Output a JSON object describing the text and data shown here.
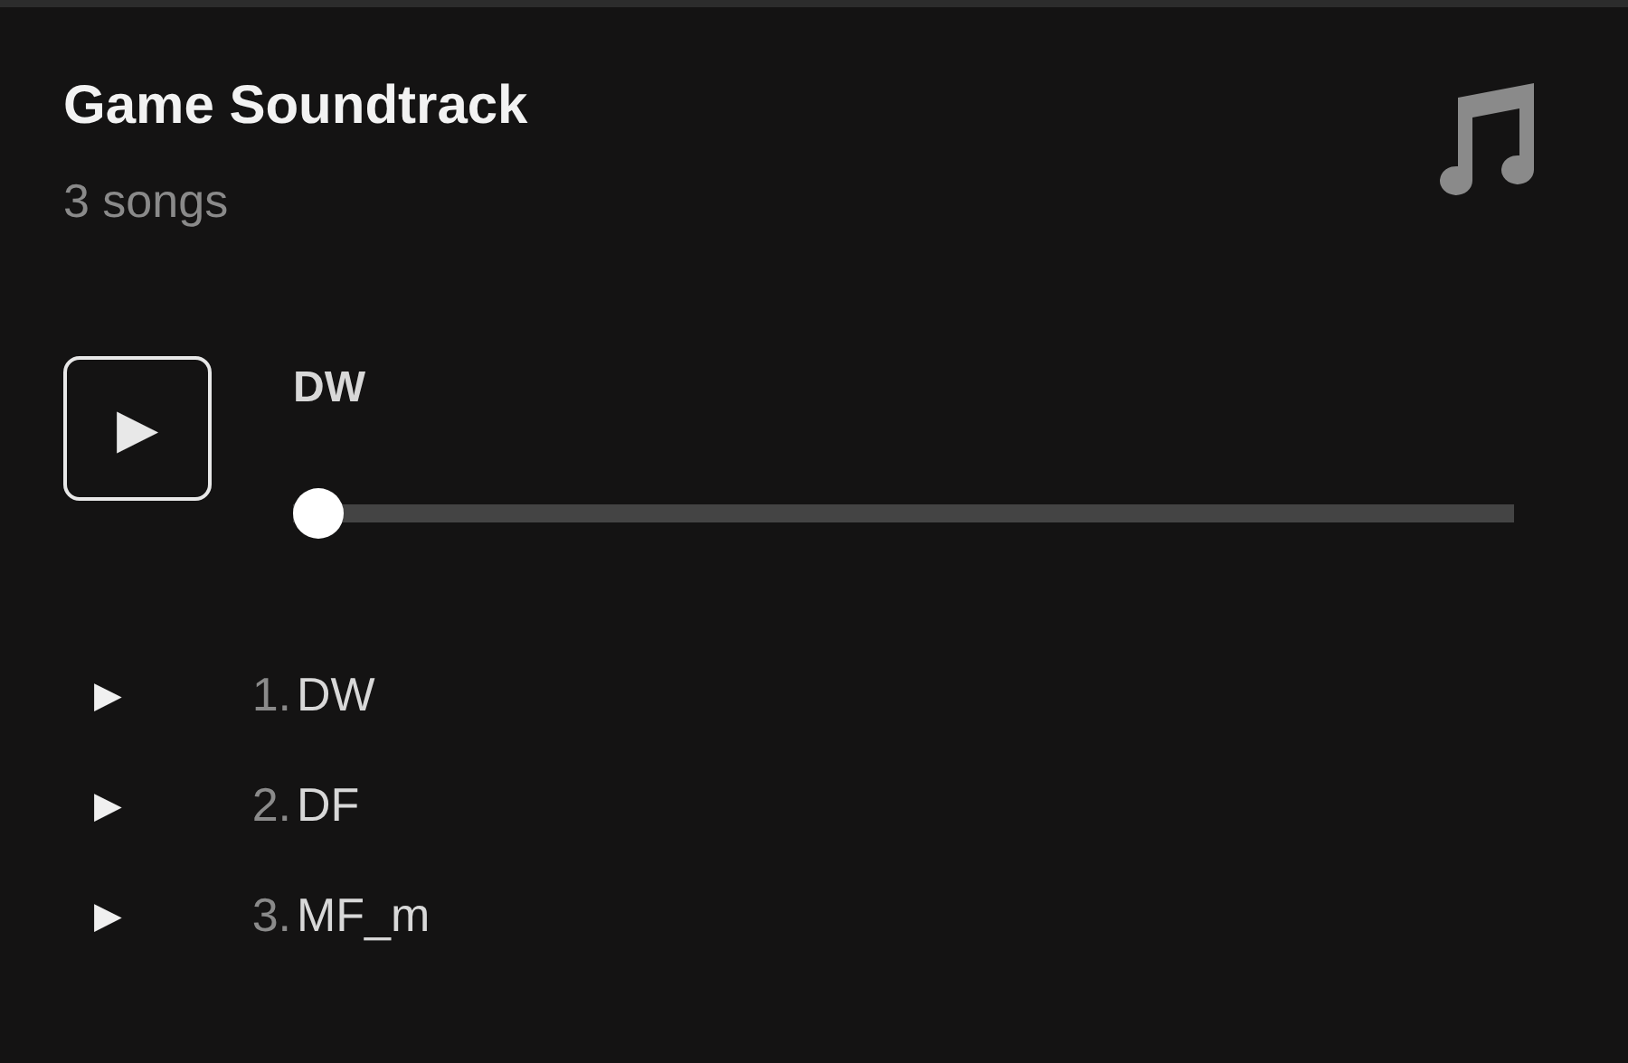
{
  "playlist": {
    "title": "Game Soundtrack",
    "count": "3 songs"
  },
  "player": {
    "play_symbol": "▶",
    "track": "DW",
    "progress": {
      "level": 0
    }
  },
  "songs": [
    {
      "play_symbol": "▶",
      "number": "1.",
      "title": "DW"
    },
    {
      "play_symbol": "▶",
      "number": "2.",
      "title": "DF"
    },
    {
      "play_symbol": "▶",
      "number": "3.",
      "title": "MF_m"
    }
  ]
}
